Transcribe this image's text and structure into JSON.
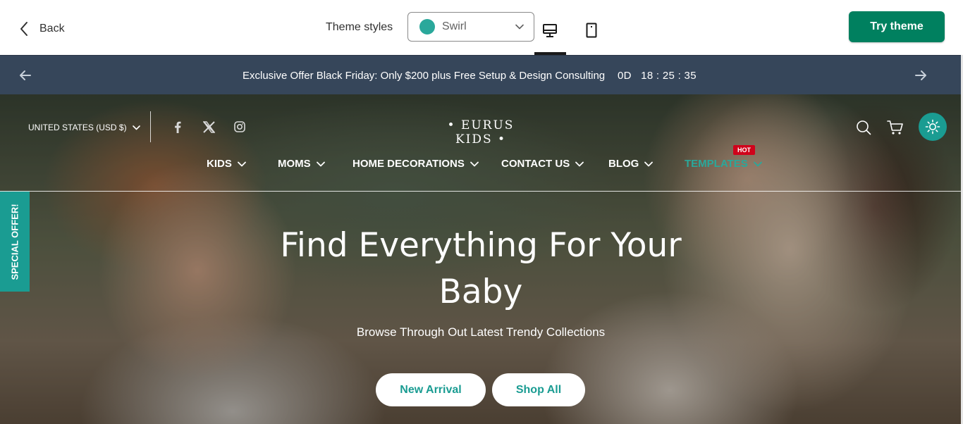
{
  "toolbar": {
    "back_label": "Back",
    "theme_styles_label": "Theme styles",
    "style_select": {
      "value": "Swirl",
      "swatch_color": "#2aa89b"
    },
    "devices": [
      "desktop",
      "mobile"
    ],
    "selected_device": "desktop",
    "try_label": "Try theme",
    "accent_color": "#00805f"
  },
  "announcement": {
    "text": "Exclusive Offer Black Friday: Only $200 plus Free Setup & Design Consulting",
    "countdown": "0D   18 : 25 : 35",
    "background_color": "#36465a"
  },
  "header": {
    "currency": "UNITED STATES (USD $)",
    "brand": "• EURUS KIDS •",
    "social_icons": [
      "facebook-icon",
      "x-icon",
      "instagram-icon"
    ],
    "nav": [
      {
        "label": "KIDS"
      },
      {
        "label": "MOMS"
      },
      {
        "label": "HOME DECORATIONS"
      },
      {
        "label": "CONTACT US"
      },
      {
        "label": "BLOG"
      },
      {
        "label": "TEMPLATES",
        "badge": "HOT"
      }
    ],
    "accent_color": "#1a9c92",
    "badge_color": "#d0021b"
  },
  "side_tab": {
    "label": "SPECIAL OFFER!"
  },
  "hero": {
    "title": "Find Everything For Your Baby",
    "subtitle": "Browse Through Out Latest Trendy Collections",
    "buttons": [
      "New Arrival",
      "Shop All"
    ]
  }
}
